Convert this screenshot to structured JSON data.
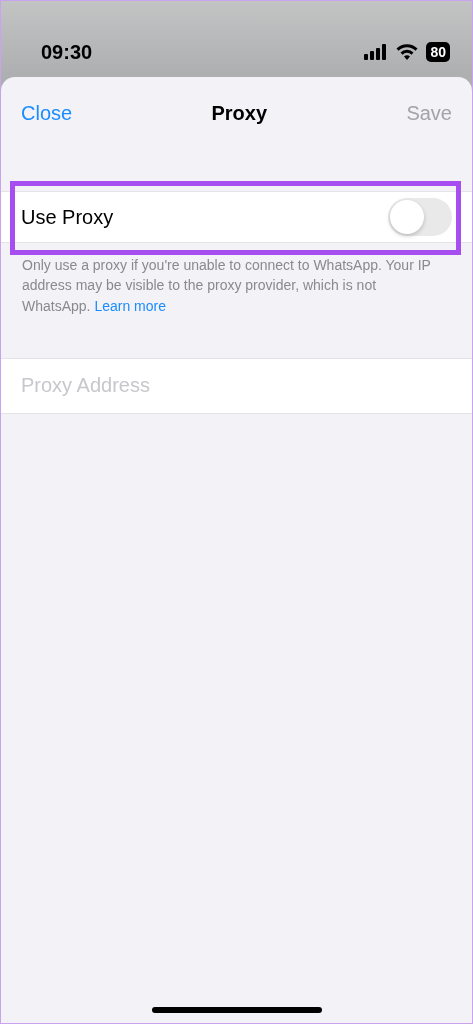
{
  "status_bar": {
    "time": "09:30",
    "battery": "80"
  },
  "nav": {
    "close": "Close",
    "title": "Proxy",
    "save": "Save",
    "save_disabled": true
  },
  "use_proxy": {
    "label": "Use Proxy",
    "on": false,
    "highlighted": true
  },
  "footnote": {
    "text": "Only use a proxy if you're unable to connect to WhatsApp. Your IP address may be visible to the proxy provider, which is not WhatsApp.",
    "link": "Learn more"
  },
  "proxy_address": {
    "placeholder": "Proxy Address"
  }
}
